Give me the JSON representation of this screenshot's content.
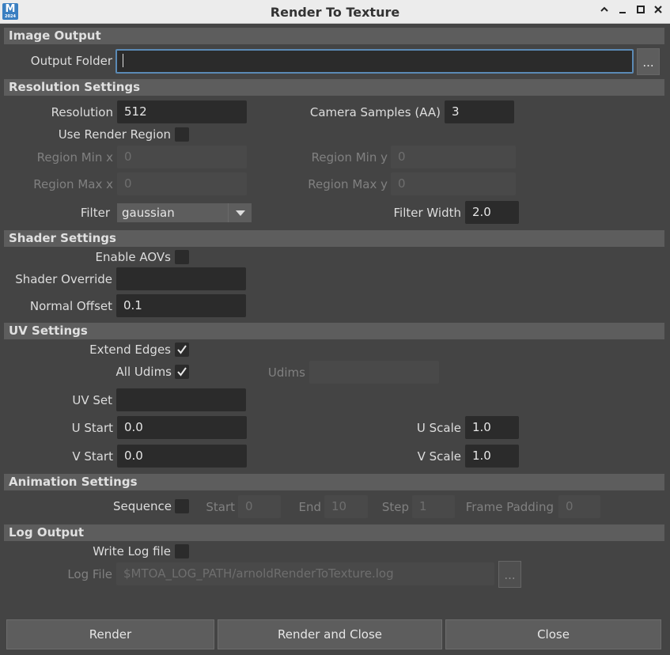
{
  "window": {
    "title": "Render To Texture",
    "app_icon_letter": "M",
    "app_icon_sub": "2024",
    "controls": [
      "^",
      "_",
      "□",
      "✕"
    ]
  },
  "image_output": {
    "header": "Image Output",
    "output_folder_label": "Output Folder",
    "output_folder_value": "",
    "browse_label": "..."
  },
  "resolution": {
    "header": "Resolution Settings",
    "resolution_label": "Resolution",
    "resolution_value": "512",
    "camera_samples_label": "Camera Samples (AA)",
    "camera_samples_value": "3",
    "use_render_region_label": "Use Render Region",
    "use_render_region": false,
    "region_min_x_label": "Region Min x",
    "region_min_x_value": "0",
    "region_min_y_label": "Region Min y",
    "region_min_y_value": "0",
    "region_max_x_label": "Region Max x",
    "region_max_x_value": "0",
    "region_max_y_label": "Region Max y",
    "region_max_y_value": "0",
    "filter_label": "Filter",
    "filter_value": "gaussian",
    "filter_width_label": "Filter Width",
    "filter_width_value": "2.0"
  },
  "shader": {
    "header": "Shader Settings",
    "enable_aovs_label": "Enable AOVs",
    "enable_aovs": false,
    "shader_override_label": "Shader Override",
    "shader_override_value": "",
    "normal_offset_label": "Normal Offset",
    "normal_offset_value": "0.1"
  },
  "uv": {
    "header": "UV Settings",
    "extend_edges_label": "Extend Edges",
    "extend_edges": true,
    "all_udims_label": "All Udims",
    "all_udims": true,
    "udims_label": "Udims",
    "udims_value": "",
    "uv_set_label": "UV Set",
    "uv_set_value": "",
    "u_start_label": "U Start",
    "u_start_value": "0.0",
    "u_scale_label": "U Scale",
    "u_scale_value": "1.0",
    "v_start_label": "V Start",
    "v_start_value": "0.0",
    "v_scale_label": "V Scale",
    "v_scale_value": "1.0"
  },
  "animation": {
    "header": "Animation Settings",
    "sequence_label": "Sequence",
    "sequence": false,
    "start_label": "Start",
    "start_value": "0",
    "end_label": "End",
    "end_value": "10",
    "step_label": "Step",
    "step_value": "1",
    "frame_padding_label": "Frame Padding",
    "frame_padding_value": "0"
  },
  "log": {
    "header": "Log Output",
    "write_log_label": "Write Log file",
    "write_log": false,
    "log_file_label": "Log File",
    "log_file_value": "$MTOA_LOG_PATH/arnoldRenderToTexture.log",
    "browse_label": "..."
  },
  "buttons": {
    "render": "Render",
    "render_and_close": "Render and Close",
    "close": "Close"
  },
  "colors": {
    "background": "#444444",
    "section_header": "#5d5d5d",
    "field": "#2b2b2b",
    "focus_border": "#5b8ab5",
    "app_icon": "#3a7fc1"
  }
}
